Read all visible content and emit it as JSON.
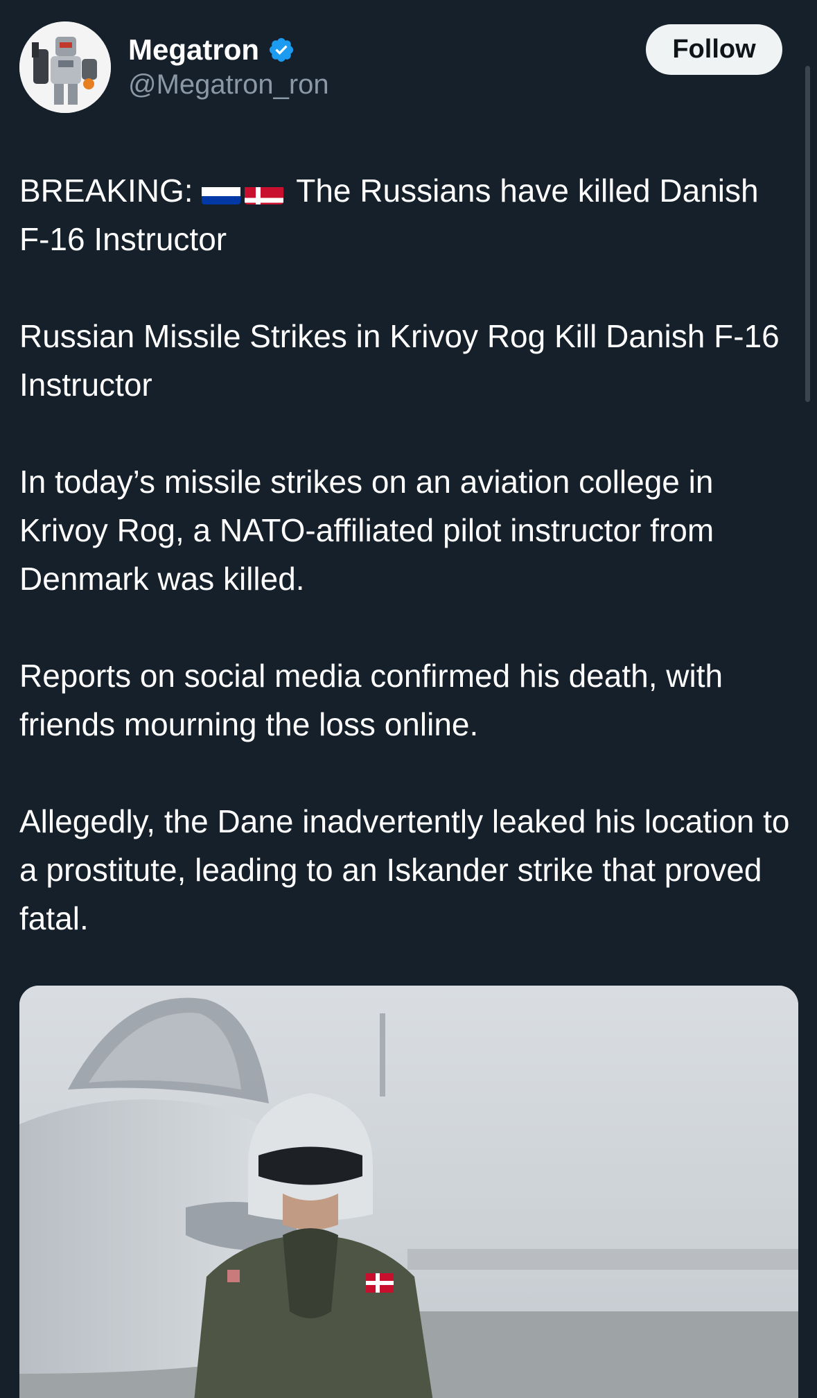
{
  "author": {
    "display_name": "Megatron",
    "handle": "@Megatron_ron",
    "verified": true,
    "avatar_icon": "robot-avatar-icon"
  },
  "actions": {
    "follow_label": "Follow"
  },
  "tweet": {
    "line1_prefix": "BREAKING: ",
    "flags": [
      "russia-flag-icon",
      "denmark-flag-icon"
    ],
    "line1_rest": " The Russians have killed Danish F-16 Instructor",
    "para2": "Russian Missile Strikes in Krivoy Rog Kill Danish F-16 Instructor",
    "para3": "In today’s missile strikes on an aviation college in Krivoy Rog, a NATO-affiliated pilot instructor from Denmark was killed.",
    "para4": "Reports on social media confirmed his death, with friends mourning the loss online.",
    "para5": "Allegedly, the Dane inadvertently leaked his location to a prostitute, leading to an Iskander strike that proved fatal."
  },
  "media": {
    "description_icon": "pilot-photo-image"
  },
  "colors": {
    "background": "#15202b",
    "text": "#ffffff",
    "secondary_text": "#8b98a5",
    "verified_blue": "#1d9bf0",
    "follow_bg": "#eff3f4"
  }
}
